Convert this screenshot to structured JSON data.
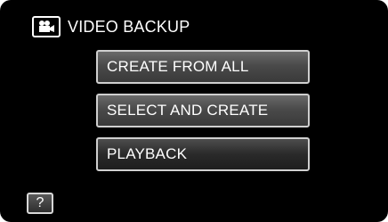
{
  "header": {
    "title": "VIDEO BACKUP",
    "icon": "video-camera-icon"
  },
  "menu": {
    "items": [
      {
        "label": "CREATE FROM ALL"
      },
      {
        "label": "SELECT AND CREATE"
      },
      {
        "label": "PLAYBACK"
      }
    ]
  },
  "help": {
    "label": "?"
  },
  "colors": {
    "background": "#000000",
    "button_border": "#cfcfcf",
    "text": "#ffffff"
  }
}
